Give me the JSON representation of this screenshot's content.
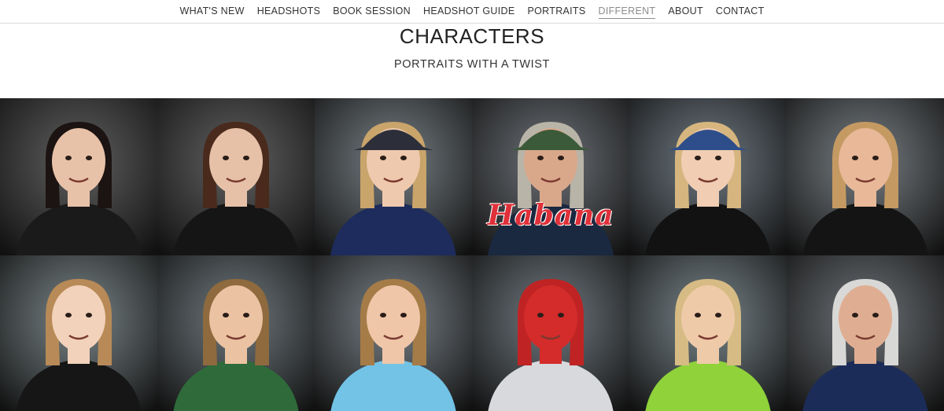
{
  "nav": {
    "items": [
      {
        "label": "WHAT'S NEW",
        "active": false
      },
      {
        "label": "HEADSHOTS",
        "active": false
      },
      {
        "label": "BOOK SESSION",
        "active": false
      },
      {
        "label": "HEADSHOT GUIDE",
        "active": false
      },
      {
        "label": "PORTRAITS",
        "active": false
      },
      {
        "label": "DIFFERENT",
        "active": true
      },
      {
        "label": "ABOUT",
        "active": false
      },
      {
        "label": "CONTACT",
        "active": false
      }
    ]
  },
  "header": {
    "title": "CHARACTERS",
    "subtitle": "PORTRAITS WITH A TWIST"
  },
  "gallery": {
    "photos": [
      {
        "name": "woman-leather-jacket-photo",
        "skin": "#e8c2a8",
        "hair": "#1c1412",
        "shirt": "#1a1a1a",
        "bg": "#2a2a2a",
        "hat": ""
      },
      {
        "name": "woman-studded-jacket-photo",
        "skin": "#e6c1a7",
        "hair": "#4a2a1c",
        "shirt": "#151515",
        "bg": "#2c2c2c",
        "hat": ""
      },
      {
        "name": "boy-cap-lollipop-photo",
        "skin": "#efc9ad",
        "hair": "#c9a46b",
        "shirt": "#1d2c5c",
        "bg": "#485258",
        "hat": "#2c2f3a"
      },
      {
        "name": "man-cigar-habana-photo",
        "skin": "#d9a88a",
        "hair": "#b9b4a8",
        "shirt": "#1a2840",
        "bg": "#3b4148",
        "hat": "#3b5a3a"
      },
      {
        "name": "girl-blue-hat-smile-photo",
        "skin": "#f0cdb3",
        "hair": "#d7b57e",
        "shirt": "#121212",
        "bg": "#3d4a55",
        "hat": "#2d4e8a"
      },
      {
        "name": "woman-surprised-hands-photo",
        "skin": "#e8b898",
        "hair": "#c49a62",
        "shirt": "#141414",
        "bg": "#4a5258",
        "hat": ""
      },
      {
        "name": "girl-funny-face-photo",
        "skin": "#f2d2bb",
        "hair": "#b88a57",
        "shirt": "#161616",
        "bg": "#4c5a5e",
        "hat": ""
      },
      {
        "name": "boy-green-jersey-photo",
        "skin": "#ebc3a2",
        "hair": "#8e6a3e",
        "shirt": "#2f6a3a",
        "bg": "#3e4a50",
        "hat": ""
      },
      {
        "name": "boy-light-blue-tee-photo",
        "skin": "#efc6a8",
        "hair": "#a57c47",
        "shirt": "#72c3e6",
        "bg": "#4a545c",
        "hat": ""
      },
      {
        "name": "child-spiderman-mask-photo",
        "skin": "#d42b2b",
        "hair": "#c02323",
        "shirt": "#d7d9dc",
        "bg": "#3f4a52",
        "hat": ""
      },
      {
        "name": "boy-lime-shirt-photo",
        "skin": "#efcaa9",
        "hair": "#d6bb84",
        "shirt": "#8fd23a",
        "bg": "#4a5a60",
        "hat": ""
      },
      {
        "name": "man-hand-face-photo",
        "skin": "#dfae92",
        "hair": "#d8d8d6",
        "shirt": "#1c2c58",
        "bg": "#3c4248",
        "hat": ""
      }
    ],
    "poster_title": "Habana"
  }
}
